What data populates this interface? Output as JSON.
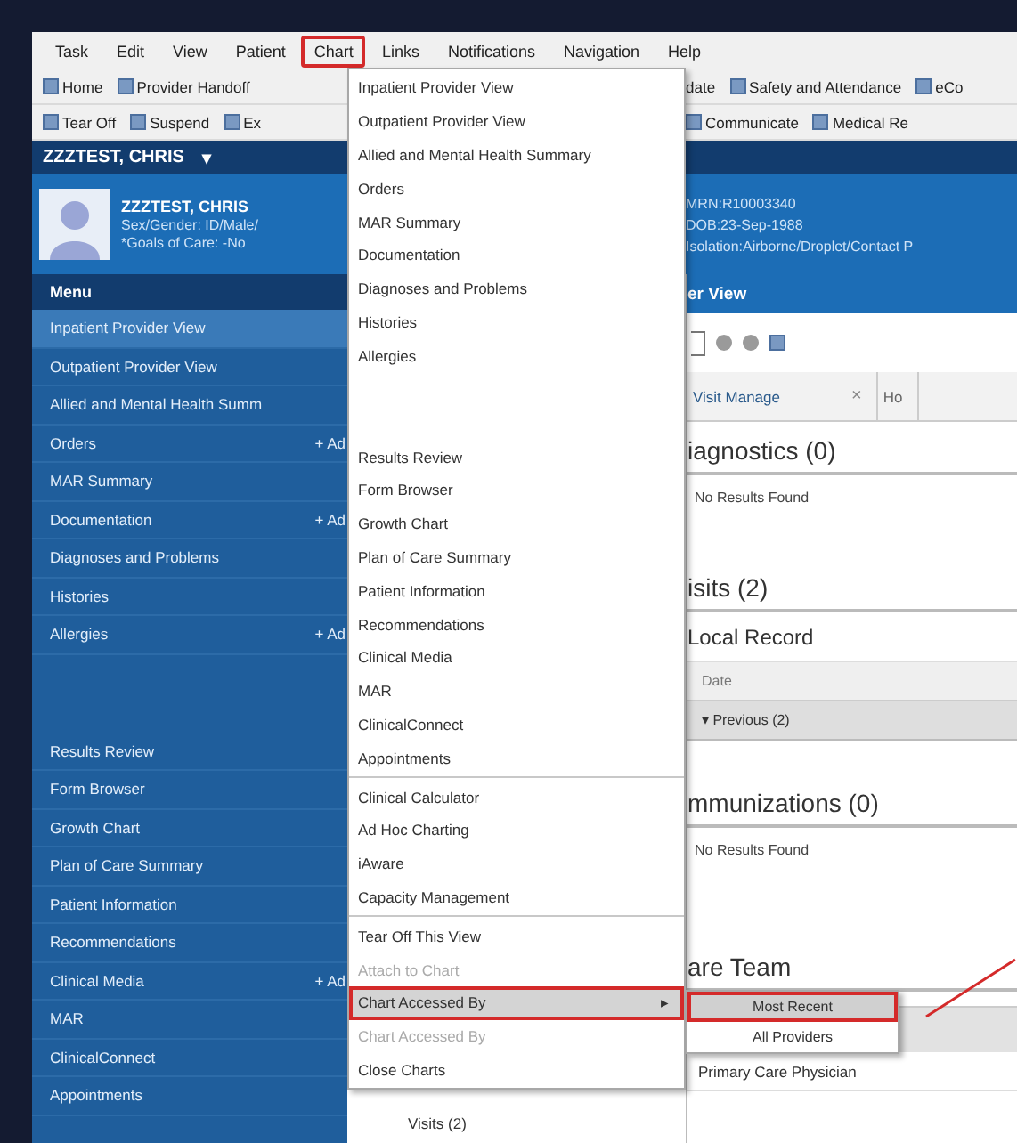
{
  "menu_bar": [
    {
      "label": "Task",
      "selected": false
    },
    {
      "label": "Edit",
      "selected": false
    },
    {
      "label": "View",
      "selected": false
    },
    {
      "label": "Patient",
      "selected": false
    },
    {
      "label": "Chart",
      "selected": true
    },
    {
      "label": "Links",
      "selected": false
    },
    {
      "label": "Notifications",
      "selected": false
    },
    {
      "label": "Navigation",
      "selected": false
    },
    {
      "label": "Help",
      "selected": false
    }
  ],
  "toolbar_1": {
    "left": [
      "Home",
      "Provider Handoff"
    ],
    "right": [
      "date",
      "Safety and Attendance",
      "eCo"
    ]
  },
  "toolbar_2": {
    "left": [
      "Tear Off",
      "Suspend",
      "Ex"
    ],
    "right": [
      "Communicate",
      "Medical Re"
    ]
  },
  "patient_tab": {
    "name": "ZZZTEST, CHRIS",
    "caret": "▾"
  },
  "banner": {
    "left": [
      "ZZZTEST, CHRIS",
      "Sex/Gender: ID/Male/",
      "*Goals of Care: -No"
    ],
    "right": [
      "MRN:R10003340",
      "DOB:23-Sep-1988",
      "Isolation:Airborne/Droplet/Contact   P"
    ]
  },
  "sidebar": {
    "header": "Menu",
    "items": [
      {
        "kind": "item",
        "label": "Inpatient Provider View",
        "selected": true
      },
      {
        "kind": "item",
        "label": "Outpatient Provider View",
        "selected": false
      },
      {
        "kind": "item",
        "label": "Allied and Mental Health Summ",
        "selected": false
      },
      {
        "kind": "item",
        "label": "Orders",
        "selected": false,
        "action": "+ Ad"
      },
      {
        "kind": "item",
        "label": "MAR Summary",
        "selected": false
      },
      {
        "kind": "item",
        "label": "Documentation",
        "selected": false,
        "action": "+ Ad"
      },
      {
        "kind": "item",
        "label": "Diagnoses and Problems",
        "selected": false
      },
      {
        "kind": "item",
        "label": "Histories",
        "selected": false
      },
      {
        "kind": "item",
        "label": "Allergies",
        "selected": false,
        "action": "+ Ad"
      },
      {
        "kind": "gap"
      },
      {
        "kind": "item",
        "label": "Results Review",
        "selected": false
      },
      {
        "kind": "item",
        "label": "Form Browser",
        "selected": false
      },
      {
        "kind": "item",
        "label": "Growth Chart",
        "selected": false
      },
      {
        "kind": "item",
        "label": "Plan of Care Summary",
        "selected": false
      },
      {
        "kind": "item",
        "label": "Patient Information",
        "selected": false
      },
      {
        "kind": "item",
        "label": "Recommendations",
        "selected": false
      },
      {
        "kind": "item",
        "label": "Clinical Media",
        "selected": false,
        "action": "+ Ad"
      },
      {
        "kind": "item",
        "label": "MAR",
        "selected": false
      },
      {
        "kind": "item",
        "label": "ClinicalConnect",
        "selected": false
      },
      {
        "kind": "item",
        "label": "Appointments",
        "selected": false
      }
    ]
  },
  "chart_menu": [
    {
      "kind": "item",
      "label": "Inpatient Provider View",
      "disabled": false,
      "selected": false
    },
    {
      "kind": "item",
      "label": "Outpatient Provider View",
      "disabled": false,
      "selected": false
    },
    {
      "kind": "item",
      "label": "Allied and Mental Health Summary",
      "disabled": false,
      "selected": false
    },
    {
      "kind": "item",
      "label": "Orders",
      "disabled": false,
      "selected": false
    },
    {
      "kind": "item",
      "label": "MAR Summary",
      "disabled": false,
      "selected": false
    },
    {
      "kind": "item",
      "label": "Documentation",
      "disabled": false,
      "selected": false
    },
    {
      "kind": "item",
      "label": "Diagnoses and Problems",
      "disabled": false,
      "selected": false
    },
    {
      "kind": "item",
      "label": "Histories",
      "disabled": false,
      "selected": false
    },
    {
      "kind": "item",
      "label": "Allergies",
      "disabled": false,
      "selected": false
    },
    {
      "kind": "gap"
    },
    {
      "kind": "item",
      "label": "Results Review",
      "disabled": false,
      "selected": false
    },
    {
      "kind": "item",
      "label": "Form Browser",
      "disabled": false,
      "selected": false
    },
    {
      "kind": "item",
      "label": "Growth Chart",
      "disabled": false,
      "selected": false
    },
    {
      "kind": "item",
      "label": "Plan of Care Summary",
      "disabled": false,
      "selected": false
    },
    {
      "kind": "item",
      "label": "Patient Information",
      "disabled": false,
      "selected": false
    },
    {
      "kind": "item",
      "label": "Recommendations",
      "disabled": false,
      "selected": false
    },
    {
      "kind": "item",
      "label": "Clinical Media",
      "disabled": false,
      "selected": false
    },
    {
      "kind": "item",
      "label": "MAR",
      "disabled": false,
      "selected": false
    },
    {
      "kind": "item",
      "label": "ClinicalConnect",
      "disabled": false,
      "selected": false
    },
    {
      "kind": "item",
      "label": "Appointments",
      "disabled": false,
      "selected": false
    },
    {
      "kind": "separator"
    },
    {
      "kind": "item",
      "label": "Clinical Calculator",
      "disabled": false,
      "selected": false
    },
    {
      "kind": "item",
      "label": "Ad Hoc Charting",
      "disabled": false,
      "selected": false
    },
    {
      "kind": "item",
      "label": "iAware",
      "disabled": false,
      "selected": false
    },
    {
      "kind": "item",
      "label": "Capacity Management",
      "disabled": false,
      "selected": false
    },
    {
      "kind": "separator"
    },
    {
      "kind": "item",
      "label": "Tear Off This View",
      "disabled": false,
      "selected": false
    },
    {
      "kind": "item",
      "label": "Attach to Chart",
      "disabled": true,
      "selected": false
    },
    {
      "kind": "item",
      "label": "Chart Accessed By",
      "disabled": false,
      "selected": true,
      "submenu": "▸"
    },
    {
      "kind": "item",
      "label": "Chart Accessed By",
      "disabled": true,
      "selected": false
    },
    {
      "kind": "item",
      "label": "Close Charts",
      "disabled": false,
      "selected": false
    }
  ],
  "submenu": [
    {
      "label": "Most Recent",
      "selected": true
    },
    {
      "label": "All Providers",
      "selected": false
    }
  ],
  "content": {
    "view_title": "er View",
    "tabs": [
      {
        "label": "Visit Manage",
        "close": "×",
        "selected": true
      },
      {
        "label": "Ho",
        "selected": false
      }
    ],
    "behind_menu_label": "Visits (2)",
    "diagnostics": {
      "title": "iagnostics (0)",
      "empty": "No Results Found"
    },
    "visits": {
      "title": "isits (2)",
      "subtitle": "Local Record",
      "column": "Date",
      "group": "▾ Previous (2)"
    },
    "immunizations": {
      "title": "mmunizations (0)",
      "empty": "No Results Found"
    },
    "care_team": {
      "title": "are Team",
      "row": "Primary Care Physician"
    }
  }
}
